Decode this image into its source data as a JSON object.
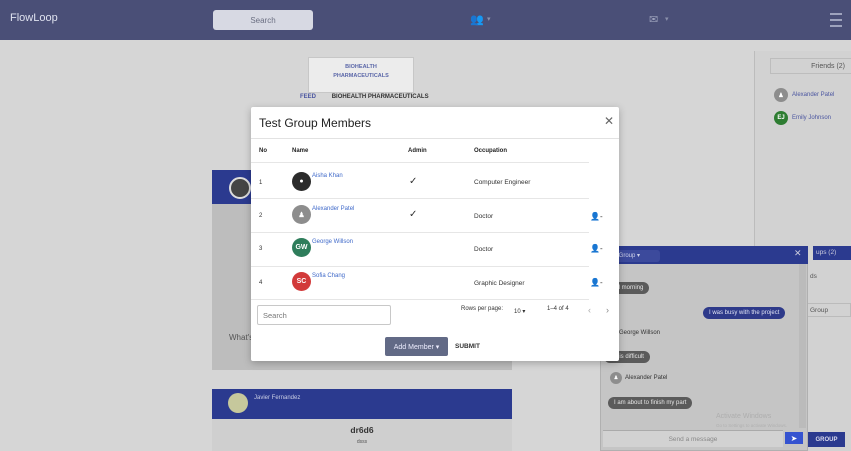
{
  "topbar": {
    "brand": "FlowLoop",
    "search_label": "Search",
    "nav_icons": [
      {
        "name": "people-icon",
        "glyph": "👥"
      },
      {
        "name": "messages-icon",
        "glyph": "✉"
      }
    ],
    "caret": "▾",
    "menu_icon": "hamburger"
  },
  "background_page": {
    "org_card_line1": "BIOHEALTH",
    "org_card_line2": "PHARMACEUTICALS",
    "tabs": [
      "FEED",
      "BIOHEALTH PHARMACEUTICALS"
    ],
    "composer_placeholder": "What's",
    "post2": {
      "author": "Javier Fernandez",
      "title": "dr6d6",
      "subtitle": "dsss"
    }
  },
  "friends": {
    "title": "Friends (2)",
    "items": [
      {
        "name": "Alexander Patel",
        "initials": "",
        "color": "#8d8d8d"
      },
      {
        "name": "Emily Johnson",
        "initials": "EJ",
        "color": "#2e7d32"
      }
    ]
  },
  "groups": {
    "title": "ups (2)",
    "row1": "ds",
    "row2": "Group",
    "button": "GROUP"
  },
  "chat": {
    "group_select": "est Group ▾",
    "close": "✕",
    "messages": [
      {
        "side": "left",
        "text": "ood morning"
      },
      {
        "side": "right",
        "text": "I was busy with the project"
      },
      {
        "side": "name",
        "text": "George Willson",
        "initials": "W"
      },
      {
        "side": "left",
        "text": "s it is difficult"
      },
      {
        "side": "name",
        "text": "Alexander Patel",
        "initials": ""
      },
      {
        "side": "left",
        "text": "I am about to finish my part"
      }
    ],
    "input_placeholder": "Send a message",
    "send_glyph": "➤",
    "watermark_title": "Activate Windows",
    "watermark_sub": "Go to Settings to activate Windows."
  },
  "modal": {
    "title": "Test Group Members",
    "close": "✕",
    "headers": {
      "no": "No",
      "name": "Name",
      "admin": "Admin",
      "occupation": "Occupation"
    },
    "rows": [
      {
        "no": "1",
        "name": "Aisha Khan",
        "initials": "",
        "avatar_color": "#2b2b2b",
        "admin": "✓",
        "occupation": "Computer Engineer",
        "removable": ""
      },
      {
        "no": "2",
        "name": "Alexander Patel",
        "initials": "",
        "avatar_color": "#8d8d8d",
        "admin": "✓",
        "occupation": "Doctor",
        "removable": "👤-"
      },
      {
        "no": "3",
        "name": "George Willson",
        "initials": "GW",
        "avatar_color": "#2e7d5b",
        "admin": "",
        "occupation": "Doctor",
        "removable": "👤-"
      },
      {
        "no": "4",
        "name": "Sofia Chang",
        "initials": "SC",
        "avatar_color": "#d23a3a",
        "admin": "",
        "occupation": "Graphic Designer",
        "removable": "👤-"
      }
    ],
    "search_placeholder": "Search",
    "rows_per_page_label": "Rows per page:",
    "rows_per_page_value": "10 ▾",
    "range": "1–4 of 4",
    "prev": "‹",
    "next": "›",
    "add_member": "Add Member ▾",
    "submit": "SUBMIT"
  }
}
